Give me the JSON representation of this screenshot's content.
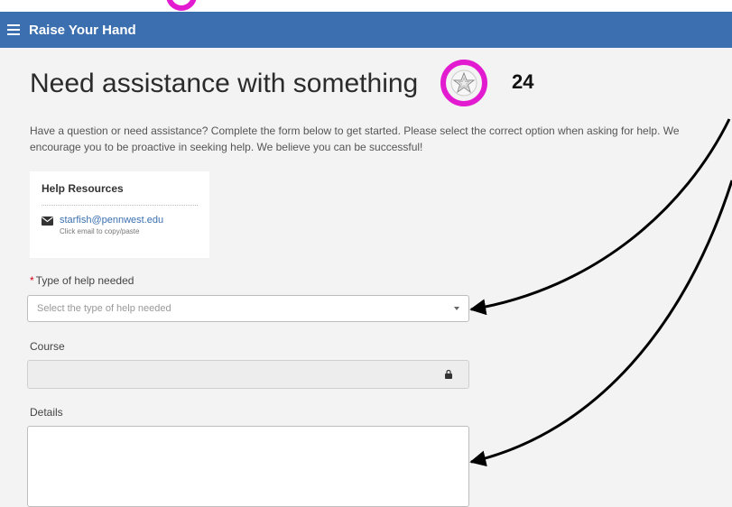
{
  "header": {
    "title": "Raise Your Hand"
  },
  "page": {
    "title": "Need assistance with something",
    "title_end": "?",
    "annotation_number": "24",
    "intro": "Have a question or need assistance? Complete the form below to get started. Please select the correct option when asking for help. We encourage you to be proactive in seeking help. We believe you can be successful!"
  },
  "resources": {
    "title": "Help Resources",
    "email": "starfish@pennwest.edu",
    "hint": "Click email to copy/paste"
  },
  "form": {
    "type_label": "Type of help needed",
    "required_mark": "*",
    "type_placeholder": "Select the type of help needed",
    "course_label": "Course",
    "details_label": "Details"
  },
  "colors": {
    "header_bg": "#3b6fb0",
    "highlight": "#e21bd0",
    "link": "#3b6fb0"
  },
  "icons": [
    "menu-icon",
    "starfish-icon",
    "mail-icon",
    "caret-down-icon",
    "lock-icon"
  ]
}
